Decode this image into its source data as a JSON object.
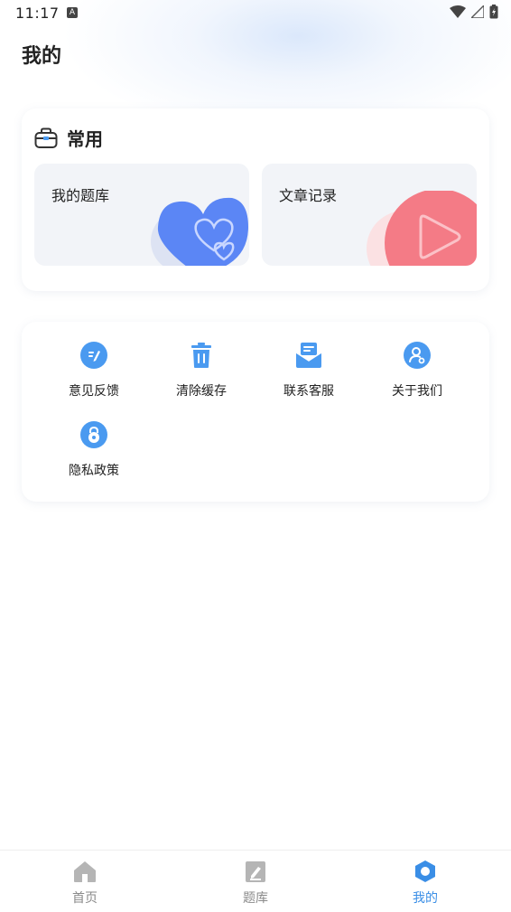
{
  "status_bar": {
    "time": "11:17",
    "badge": "A"
  },
  "page": {
    "title": "我的"
  },
  "common": {
    "title": "常用",
    "tiles": [
      {
        "label": "我的题库"
      },
      {
        "label": "文章记录"
      }
    ]
  },
  "menu": {
    "items": [
      {
        "label": "意见反馈",
        "icon": "edit-icon"
      },
      {
        "label": "清除缓存",
        "icon": "trash-icon"
      },
      {
        "label": "联系客服",
        "icon": "mail-icon"
      },
      {
        "label": "关于我们",
        "icon": "user-settings-icon"
      },
      {
        "label": "隐私政策",
        "icon": "privacy-lock-icon"
      }
    ]
  },
  "tabbar": {
    "items": [
      {
        "label": "首页",
        "icon": "home-icon"
      },
      {
        "label": "题库",
        "icon": "notebook-icon"
      },
      {
        "label": "我的",
        "icon": "hexagon-icon",
        "active": true
      }
    ]
  },
  "colors": {
    "accent": "#3a8ee6",
    "icon_blue": "#4a9af0",
    "tile_blue": "#5b86f5",
    "tile_pink": "#f47b86"
  }
}
